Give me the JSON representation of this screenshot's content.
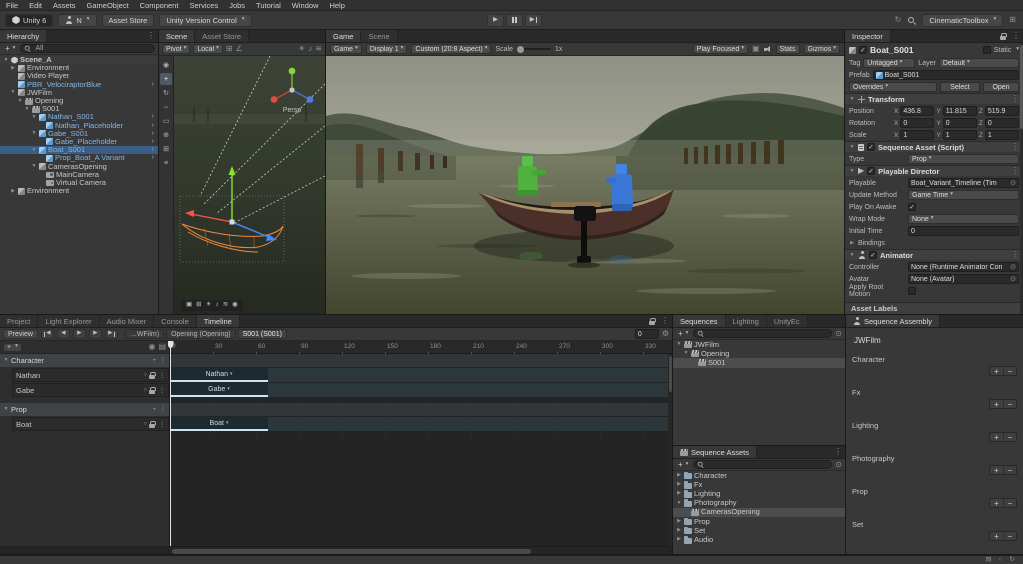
{
  "icons": {
    "plus": "+",
    "minus": "−",
    "dropdown": "▾",
    "foldout_open": "▼",
    "foldout_closed": "▶",
    "kebab": "⋮",
    "picker": "⊙",
    "prefab_chevron": "›",
    "play": "▶",
    "prev": "◀",
    "next": "▶",
    "circle": "○",
    "record": "●",
    "gear": "⚙",
    "grid": "⊞",
    "menu": "≡",
    "refresh": "↻",
    "rows": "▤",
    "clip_arrow": "▾",
    "help": "⊙",
    "sun": "☀",
    "note": "♪",
    "wave": "≋",
    "square": "▣",
    "target": "◉",
    "pan": "◉",
    "move": "+",
    "rotate": "↻",
    "scale": "⇔",
    "rect": "▭",
    "transform": "⊕",
    "angle": "∠"
  },
  "menubar": {
    "items": [
      "File",
      "Edit",
      "Assets",
      "GameObject",
      "Component",
      "Services",
      "Jobs",
      "Tutorial",
      "Window",
      "Help"
    ]
  },
  "toolbar": {
    "unity_badge": "Unity 6",
    "account_label": "N",
    "asset_store_label": "Asset Store",
    "version_control_label": "Unity Version Control",
    "layout_label": "CinematicToolbox"
  },
  "hierarchy": {
    "tab": "Hierarchy",
    "search_value": "All",
    "items": [
      {
        "label": "Scene_A",
        "depth": 0,
        "arrow": "down",
        "icon": "scene-icon",
        "style": "scene"
      },
      {
        "label": "Environment",
        "depth": 1,
        "arrow": "right",
        "icon": "cube-icon"
      },
      {
        "label": "Video Player",
        "depth": 1,
        "arrow": "none",
        "icon": "cube-icon"
      },
      {
        "label": "PBR_VelociraptorBlue",
        "depth": 1,
        "arrow": "none",
        "icon": "prefab-icon",
        "style": "prefab",
        "chev": true
      },
      {
        "label": "JWFilm",
        "depth": 1,
        "arrow": "down",
        "icon": "cube-icon"
      },
      {
        "label": "Opening",
        "depth": 2,
        "arrow": "down",
        "icon": "clap-icon"
      },
      {
        "label": "S001",
        "depth": 3,
        "arrow": "down",
        "icon": "clap-icon"
      },
      {
        "label": "Nathan_S001",
        "depth": 4,
        "arrow": "down",
        "icon": "prefab-icon",
        "style": "prefab",
        "chev": true
      },
      {
        "label": "Nathan_Placeholder",
        "depth": 5,
        "arrow": "none",
        "icon": "prefab-icon",
        "style": "prefab",
        "chev": true
      },
      {
        "label": "Gabe_S001",
        "depth": 4,
        "arrow": "down",
        "icon": "prefab-icon",
        "style": "prefab",
        "chev": true
      },
      {
        "label": "Gabe_Placeholder",
        "depth": 5,
        "arrow": "none",
        "icon": "prefab-icon",
        "style": "prefab",
        "chev": true
      },
      {
        "label": "Boat_S001",
        "depth": 4,
        "arrow": "down",
        "icon": "prefab-icon",
        "style": "prefab",
        "selected": true,
        "chev": true
      },
      {
        "label": "Prop_Boat_A Variant",
        "depth": 5,
        "arrow": "none",
        "icon": "prefab-icon",
        "style": "prefab",
        "chev": true
      },
      {
        "label": "CamerasOpening",
        "depth": 4,
        "arrow": "down",
        "icon": "cube-icon"
      },
      {
        "label": "MainCamera",
        "depth": 5,
        "arrow": "none",
        "icon": "camera-icon"
      },
      {
        "label": "Virtual Camera",
        "depth": 5,
        "arrow": "none",
        "icon": "vcam-icon"
      },
      {
        "label": "Environment",
        "depth": 1,
        "arrow": "right",
        "icon": "cube-icon"
      }
    ]
  },
  "scene_view": {
    "tabs": [
      "Scene",
      "Asset Store"
    ],
    "pivot_label": "Pivot",
    "local_label": "Local",
    "persp_label": "Persp"
  },
  "game_view": {
    "tabs": [
      "Game",
      "Scene"
    ],
    "game_menu": "Game",
    "display": "Display 1",
    "aspect": "Custom (20:8 Aspect)",
    "scale_label": "Scale",
    "scale_value": "1x",
    "play_focused": "Play Focused",
    "stats_label": "Stats",
    "gizmos_label": "Gizmos"
  },
  "inspector": {
    "tab": "Inspector",
    "name": "Boat_S001",
    "static_label": "Static",
    "tag_label": "Tag",
    "tag_value": "Untagged",
    "layer_label": "Layer",
    "layer_value": "Default",
    "prefab_label": "Prefab",
    "prefab_value": "Boat_S001",
    "overrides_label": "Overrides",
    "select_label": "Select",
    "open_label": "Open",
    "transform": {
      "title": "Transform",
      "position_label": "Position",
      "rotation_label": "Rotation",
      "scale_label": "Scale",
      "x": "X",
      "y": "Y",
      "z": "Z",
      "position": {
        "x": "436.8",
        "y": "11.815",
        "z": "515.9"
      },
      "rotation": {
        "x": "0",
        "y": "0",
        "z": "0"
      },
      "scale": {
        "x": "1",
        "y": "1",
        "z": "1"
      }
    },
    "sequence_asset": {
      "title": "Sequence Asset (Script)",
      "type_label": "Type",
      "type_value": "Prop"
    },
    "director": {
      "title": "Playable Director",
      "playable_label": "Playable",
      "playable_value": "Boat_Variant_Timeline (Tim",
      "update_label": "Update Method",
      "update_value": "Game Time",
      "awake_label": "Play On Awake",
      "wrap_label": "Wrap Mode",
      "wrap_value": "None",
      "initial_label": "Initial Time",
      "initial_value": "0",
      "bindings_label": "Bindings"
    },
    "animator": {
      "title": "Animator",
      "controller_label": "Controller",
      "controller_value": "None (Runtime Animator Con",
      "avatar_label": "Avatar",
      "avatar_value": "None (Avatar)",
      "root_label": "Apply Root Motion"
    },
    "asset_labels_label": "Asset Labels"
  },
  "bottom_tabs": [
    "Project",
    "Light Explorer",
    "Audio Mixer",
    "Console",
    "Timeline"
  ],
  "timeline": {
    "preview_label": "Preview",
    "breadcrumbs": [
      "…WFilm)",
      "Opening (Opening)",
      "S001 (S001)"
    ],
    "frame_value": "0",
    "ruler_labels": [
      "0",
      "30",
      "60",
      "90",
      "120",
      "150",
      "180",
      "210",
      "240",
      "270",
      "300",
      "330"
    ],
    "groups": [
      {
        "name": "Character",
        "tracks": [
          {
            "name": "Nathan",
            "clip": "Nathan"
          },
          {
            "name": "Gabe",
            "clip": "Gabe"
          }
        ]
      },
      {
        "name": "Prop",
        "tracks": [
          {
            "name": "Boat",
            "clip": "Boat"
          }
        ]
      }
    ]
  },
  "sequences": {
    "tabs": [
      "Sequences",
      "Lighting",
      "UnityEc"
    ],
    "items": [
      {
        "label": "JWFilm",
        "depth": 0,
        "arrow": "down",
        "icon": "clap-icon"
      },
      {
        "label": "Opening",
        "depth": 1,
        "arrow": "down",
        "icon": "clap-icon"
      },
      {
        "label": "S001",
        "depth": 2,
        "arrow": "none",
        "icon": "clap-icon",
        "selected": true
      }
    ]
  },
  "sequence_assets": {
    "title": "Sequence Assets",
    "items": [
      {
        "label": "Character",
        "depth": 0,
        "arrow": "right",
        "icon": "folder-icon"
      },
      {
        "label": "Fx",
        "depth": 0,
        "arrow": "right",
        "icon": "folder-icon"
      },
      {
        "label": "Lighting",
        "depth": 0,
        "arrow": "right",
        "icon": "folder-icon"
      },
      {
        "label": "Photography",
        "depth": 0,
        "arrow": "down",
        "icon": "folder-icon"
      },
      {
        "label": "CamerasOpening",
        "depth": 1,
        "arrow": "none",
        "icon": "clap-icon",
        "selected": true
      },
      {
        "label": "Prop",
        "depth": 0,
        "arrow": "right",
        "icon": "folder-icon"
      },
      {
        "label": "Set",
        "depth": 0,
        "arrow": "right",
        "icon": "folder-icon"
      },
      {
        "label": "Audio",
        "depth": 0,
        "arrow": "right",
        "icon": "folder-icon"
      }
    ]
  },
  "sequence_assembly": {
    "tab": "Sequence Assembly",
    "master_label": "JWFilm",
    "sections": [
      "Character",
      "Fx",
      "Lighting",
      "Photography",
      "Prop",
      "Set"
    ]
  }
}
